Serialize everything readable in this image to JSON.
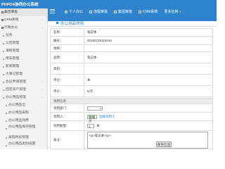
{
  "app": {
    "title": "PHPOA协同办公系统"
  },
  "topnav": [
    {
      "label": "个人办公",
      "icon": "user-icon"
    },
    {
      "label": "流程审批",
      "icon": "flow-icon"
    },
    {
      "label": "集团审批",
      "icon": "approval-icon"
    },
    {
      "label": "CRM系统",
      "icon": "crm-icon"
    },
    {
      "label": "更多应用",
      "icon": "more-icon"
    }
  ],
  "sidebar": {
    "items": [
      {
        "label": "集团审批"
      },
      {
        "label": "CRM系统"
      },
      {
        "label": "行政办公"
      },
      {
        "label": "任务"
      },
      {
        "label": "公告管理"
      },
      {
        "label": "请假管理"
      },
      {
        "label": "用车管理"
      },
      {
        "label": "新闻管理"
      },
      {
        "label": "大事记管理"
      },
      {
        "label": "会议申请管理"
      },
      {
        "label": "固定资产管理"
      },
      {
        "label": "办公用品管理"
      },
      {
        "label": "办公用品信"
      },
      {
        "label": "办公用品采购"
      },
      {
        "label": "办公用品领用"
      },
      {
        "label": "办公用品库存管理"
      },
      {
        "label": "采购时段管理"
      },
      {
        "label": "办公用品类别设置"
      }
    ]
  },
  "main": {
    "title": "办公用品领用",
    "rows": [
      {
        "label": "名称：",
        "value": "笔记本"
      },
      {
        "label": "编号：",
        "value": "20180725110416"
      },
      {
        "label": "规格：",
        "value": ""
      },
      {
        "label": "品牌：",
        "value": "笔记本"
      },
      {
        "label": "类别：",
        "value": ""
      },
      {
        "label": "单位：",
        "value": "本"
      },
      {
        "label": "单价：",
        "value": "5/元"
      }
    ],
    "form_section": "领用信息",
    "form": {
      "dept_label": "领用部门：",
      "user_label": "领用人：",
      "user_value": "管理员",
      "user_link": "选择领用人",
      "qty_label": "领用数量：",
      "qty_value": "1",
      "qty_unit": "本",
      "remark_label": "备注：",
      "remark_value": "<p>笔记本</p>"
    },
    "save_label": "保存信息"
  }
}
